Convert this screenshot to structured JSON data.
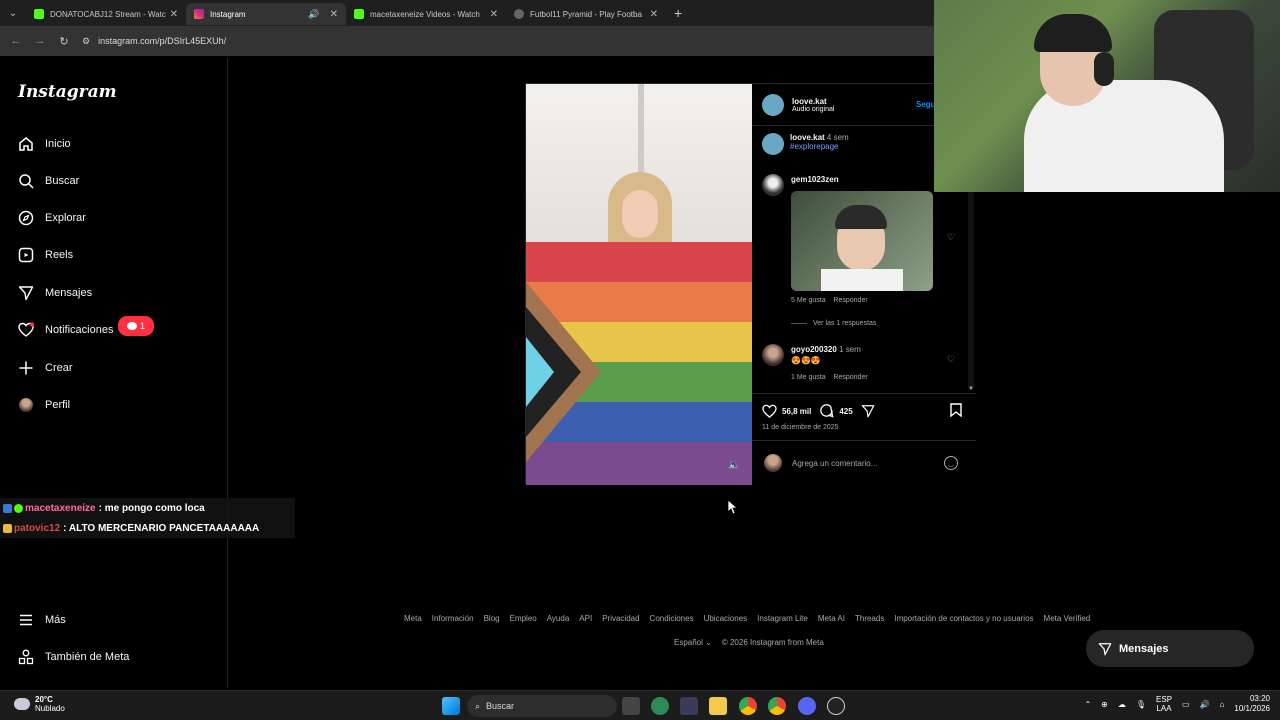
{
  "browser": {
    "tabs": [
      {
        "title": "DONATOCABJ12 Stream - Watc",
        "favicon_color": "#53fc18",
        "active": false
      },
      {
        "title": "Instagram",
        "favicon_color": "#e1306c",
        "active": true
      },
      {
        "title": "macetaxeneize Videos - Watch",
        "favicon_color": "#53fc18",
        "active": false
      },
      {
        "title": "Futbol11 Pyramid - Play Footba",
        "favicon_color": "#888888",
        "active": false
      }
    ],
    "url": "instagram.com/p/DSIrL45EXUh/"
  },
  "sidebar": {
    "logo": "Instagram",
    "items": [
      {
        "label": "Inicio",
        "icon": "home-icon"
      },
      {
        "label": "Buscar",
        "icon": "search-icon"
      },
      {
        "label": "Explorar",
        "icon": "compass-icon"
      },
      {
        "label": "Reels",
        "icon": "reels-icon"
      },
      {
        "label": "Mensajes",
        "icon": "send-icon"
      },
      {
        "label": "Notificaciones",
        "icon": "heart-icon"
      },
      {
        "label": "Crear",
        "icon": "plus-icon"
      },
      {
        "label": "Perfil",
        "icon": "profile-avatar"
      }
    ],
    "notif_badge": "1",
    "more": "Más",
    "meta": "También de Meta"
  },
  "chat": [
    {
      "user": "macetaxeneize",
      "message": ": me pongo como loca"
    },
    {
      "user": "patovic12",
      "message": ": ALTO MERCENARIO PANCETAAAAAAA"
    }
  ],
  "post": {
    "author": "loove.kat",
    "audio": "Audio original",
    "follow": "Segu",
    "caption_user": "loove.kat",
    "caption_time": "4 sem",
    "caption_tag": "#explorepage",
    "comments": [
      {
        "user": "gem1023zen",
        "likes": "5 Me gusta",
        "reply": "Responder",
        "view_replies": "Ver las 1 respuestas"
      },
      {
        "user": "goyo200320",
        "time": "1 sem",
        "text": "😍😍😍",
        "likes": "1 Me gusta",
        "reply": "Responder"
      }
    ],
    "like_count": "56,8 mil",
    "comment_count": "425",
    "date": "11 de diciembre de 2025",
    "comment_placeholder": "Agrega un comentario..."
  },
  "footer": {
    "links": [
      "Meta",
      "Información",
      "Blog",
      "Empleo",
      "Ayuda",
      "API",
      "Privacidad",
      "Condiciones",
      "Ubicaciones",
      "Instagram Lite",
      "Meta AI",
      "Threads",
      "Importación de contactos y no usuarios",
      "Meta Verified"
    ],
    "language": "Español",
    "copyright": "© 2026 Instagram from Meta"
  },
  "messages_button": "Mensajes",
  "taskbar": {
    "temp": "20°C",
    "condition": "Nublado",
    "search": "Buscar",
    "lang1": "ESP",
    "lang2": "LAA",
    "time": "03:20",
    "date": "10/1/2026"
  }
}
